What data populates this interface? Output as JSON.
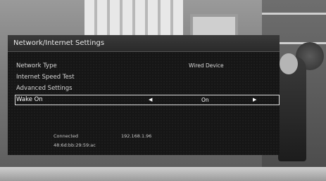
{
  "panel": {
    "title": "Network/Internet Settings"
  },
  "settings": [
    {
      "label": "Network Type",
      "value": "Wired Device"
    },
    {
      "label": "Internet Speed Test",
      "value": ""
    },
    {
      "label": "Advanced Settings",
      "value": ""
    },
    {
      "label": "Wake On",
      "value": "On",
      "left_arrow": "◀",
      "right_arrow": "▶"
    }
  ],
  "status": {
    "connection": "Connected",
    "ip_address": "192.168.1.96",
    "mac_address": "48:6d:bb:29:59:ac"
  }
}
